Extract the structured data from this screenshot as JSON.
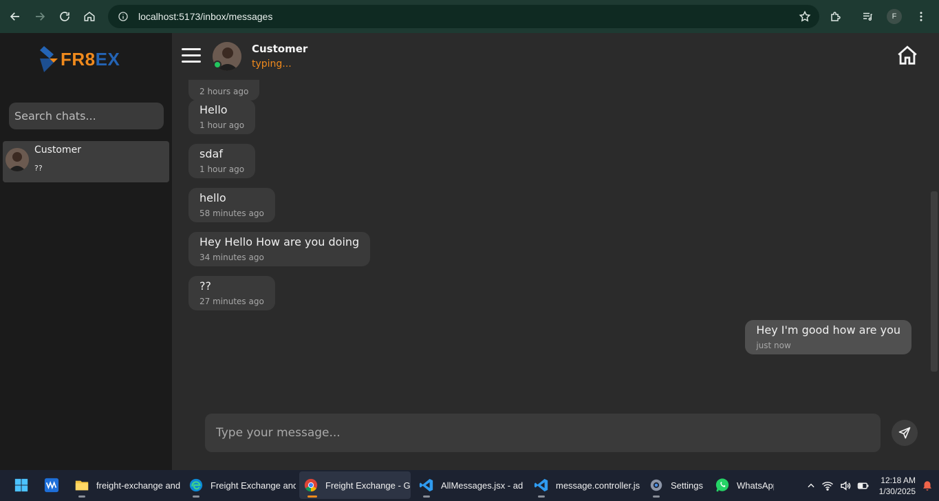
{
  "browser": {
    "url": "localhost:5173/inbox/messages",
    "profile_initial": "F"
  },
  "sidebar": {
    "logo": {
      "part1": "FR8",
      "part2": "EX"
    },
    "search_placeholder": "Search chats...",
    "chats": [
      {
        "name": "Customer",
        "preview": "??"
      }
    ]
  },
  "header": {
    "name": "Customer",
    "status": "typing..."
  },
  "messages": [
    {
      "text": "",
      "time": "2 hours ago",
      "mine": false
    },
    {
      "text": "Hello",
      "time": "1 hour ago",
      "mine": false
    },
    {
      "text": "sdaf",
      "time": "1 hour ago",
      "mine": false
    },
    {
      "text": "hello",
      "time": "58 minutes ago",
      "mine": false
    },
    {
      "text": "Hey Hello How are you doing",
      "time": "34 minutes ago",
      "mine": false
    },
    {
      "text": "??",
      "time": "27 minutes ago",
      "mine": false
    },
    {
      "text": "Hey I'm good how are you",
      "time": "just now",
      "mine": true
    }
  ],
  "composer": {
    "placeholder": "Type your message..."
  },
  "taskbar": {
    "apps": [
      {
        "label": "freight-exchange and",
        "icon": "folder-icon"
      },
      {
        "label": "Freight Exchange and",
        "icon": "edge-icon"
      },
      {
        "label": "Freight Exchange - Go",
        "icon": "chrome-icon",
        "active": true
      },
      {
        "label": "AllMessages.jsx - adm",
        "icon": "vscode-icon"
      },
      {
        "label": "message.controller.js",
        "icon": "vscode-icon"
      },
      {
        "label": "Settings",
        "icon": "settings-icon"
      },
      {
        "label": "WhatsApp",
        "icon": "whatsapp-icon"
      }
    ],
    "time": "12:18 AM",
    "date": "1/30/2025"
  },
  "colors": {
    "accent_orange": "#f08a1d",
    "brand_blue": "#2464b5",
    "online_green": "#22c55e"
  }
}
